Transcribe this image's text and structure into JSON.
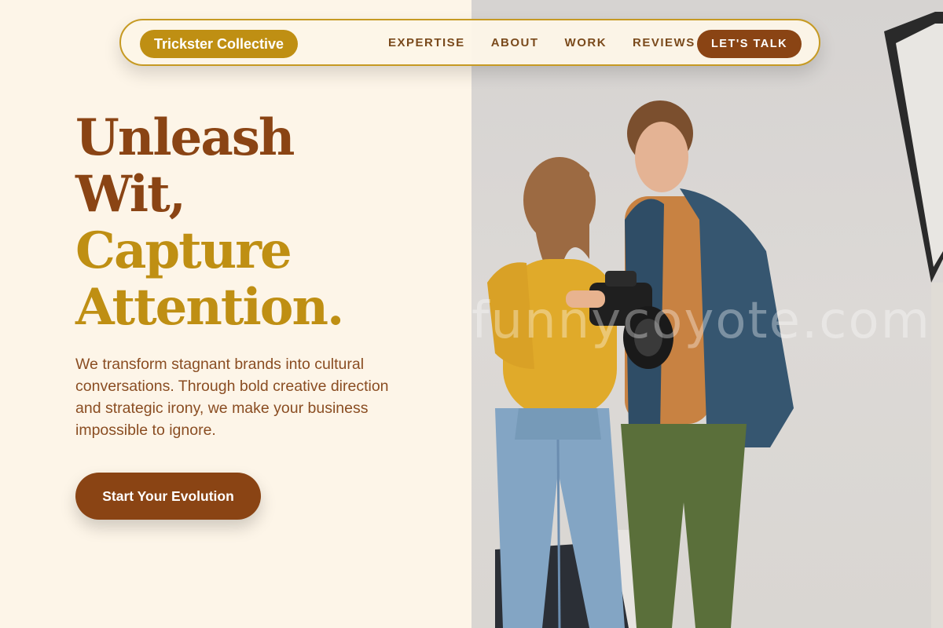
{
  "nav": {
    "logo": "Trickster Collective",
    "links": [
      "EXPERTISE",
      "ABOUT",
      "WORK",
      "REVIEWS"
    ],
    "cta": "LET'S TALK"
  },
  "hero": {
    "title_line1": "Unleash",
    "title_line2": "Wit,",
    "title_line3": "Capture",
    "title_line4": "Attention.",
    "subtitle": "We transform stagnant brands into cultural conversations. Through bold creative direction and strategic irony, we make your business impossible to ignore.",
    "button": "Start Your Evolution"
  },
  "image": {
    "watermark": "funnycoyote.com",
    "description_icon": "photo-two-people-camera"
  },
  "colors": {
    "brown": "#8a4414",
    "gold": "#bf8f13",
    "background": "#fdf5e8"
  }
}
